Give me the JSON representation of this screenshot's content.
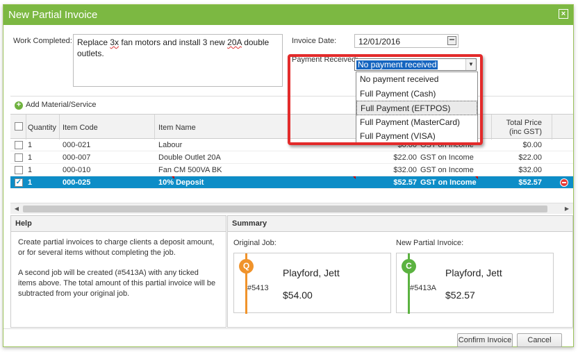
{
  "window": {
    "title": "New Partial Invoice",
    "close_glyph": "×"
  },
  "form": {
    "work_label": "Work Completed:",
    "work_text_parts": [
      "Replace ",
      "3x",
      " fan motors and install 3 new ",
      "20A",
      " double outlets."
    ],
    "invoice_date_label": "Invoice Date:",
    "invoice_date_value": "12/01/2016",
    "payment_label": "Payment Received:",
    "payment_selected": "No payment received",
    "payment_options": [
      "No payment received",
      "Full Payment (Cash)",
      "Full Payment (EFTPOS)",
      "Full Payment (MasterCard)",
      "Full Payment (VISA)"
    ],
    "hovered_option": "Full Payment (EFTPOS)"
  },
  "toolbar": {
    "add_label": "Add Material/Service",
    "add_glyph": "+"
  },
  "grid": {
    "headers": {
      "quantity": "Quantity",
      "item_code": "Item Code",
      "item_name": "Item Name",
      "total_price_line1": "Total Price",
      "total_price_line2": "(inc GST)"
    },
    "rows": [
      {
        "checked": false,
        "qty": "1",
        "code": "000-021",
        "name": "Labour",
        "price": "$0.00",
        "tax": "GST on Income",
        "total": "$0.00"
      },
      {
        "checked": false,
        "qty": "1",
        "code": "000-007",
        "name": "Double Outlet 20A",
        "price": "$22.00",
        "tax": "GST on Income",
        "total": "$22.00"
      },
      {
        "checked": false,
        "qty": "1",
        "code": "000-010",
        "name": "Fan CM 500VA BK",
        "price": "$32.00",
        "tax": "GST on Income",
        "total": "$32.00"
      },
      {
        "checked": true,
        "qty": "1",
        "code": "000-025",
        "name": "10% Deposit",
        "price": "$52.57",
        "tax": "GST on Income",
        "total": "$52.57"
      }
    ],
    "check_glyph": "✓"
  },
  "scrollbar": {
    "left_glyph": "◀",
    "right_glyph": "▶"
  },
  "help": {
    "title": "Help",
    "para1": "Create partial invoices to charge clients a deposit amount, or for several items without completing the job.",
    "para2": "A second job will be created (#5413A) with any ticked items above. The total amount of this partial invoice will be subtracted from your original job."
  },
  "summary": {
    "title": "Summary",
    "original_label": "Original Job:",
    "new_label": "New Partial Invoice:",
    "original_card": {
      "badge": "Q",
      "job_no": "#5413",
      "client": "Playford, Jett",
      "amount": "$54.00",
      "color": "#f0932b"
    },
    "new_card": {
      "badge": "C",
      "job_no": "#5413A",
      "client": "Playford, Jett",
      "amount": "$52.57",
      "color": "#5bb240"
    }
  },
  "buttons": {
    "confirm": "Confirm Invoice",
    "cancel": "Cancel"
  },
  "colors": {
    "title_bar": "#7cb842",
    "selected_row": "#0d8dc7",
    "highlight": "#e32b2b"
  }
}
